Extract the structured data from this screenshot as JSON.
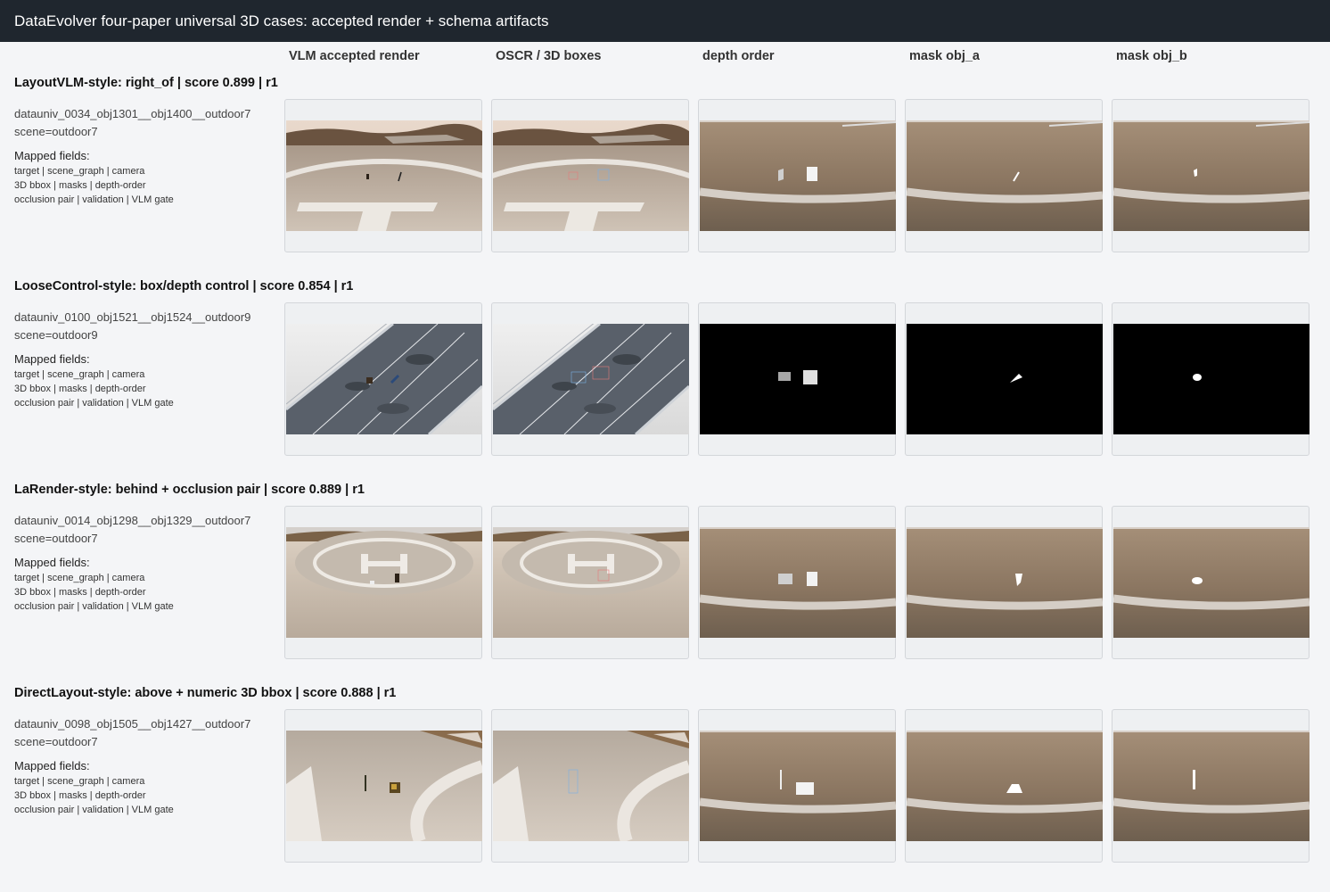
{
  "title": "DataEvolver four-paper universal 3D cases: accepted render + schema artifacts",
  "columns": [
    "VLM accepted render",
    "OSCR / 3D boxes",
    "depth order",
    "mask obj_a",
    "mask obj_b"
  ],
  "rows": [
    {
      "title": "LayoutVLM-style: right_of | score 0.899 | r1",
      "id": "datauniv_0034_obj1301__obj1400__outdoor7",
      "scene": "scene=outdoor7",
      "mapped_label": "Mapped fields:",
      "fields": [
        "target | scene_graph | camera",
        "3D bbox | masks | depth-order",
        "occlusion pair | validation | VLM gate"
      ],
      "style": "helipad-sky"
    },
    {
      "title": "LooseControl-style: box/depth control | score 0.854 | r1",
      "id": "datauniv_0100_obj1521__obj1524__outdoor9",
      "scene": "scene=outdoor9",
      "mapped_label": "Mapped fields:",
      "fields": [
        "target | scene_graph | camera",
        "3D bbox | masks | depth-order",
        "occlusion pair | validation | VLM gate"
      ],
      "style": "bridge"
    },
    {
      "title": "LaRender-style: behind + occlusion pair | score 0.889 | r1",
      "id": "datauniv_0014_obj1298__obj1329__outdoor7",
      "scene": "scene=outdoor7",
      "mapped_label": "Mapped fields:",
      "fields": [
        "target | scene_graph | camera",
        "3D bbox | masks | depth-order",
        "occlusion pair | validation | VLM gate"
      ],
      "style": "helipad-wide"
    },
    {
      "title": "DirectLayout-style: above + numeric 3D bbox | score 0.888 | r1",
      "id": "datauniv_0098_obj1505__obj1427__outdoor7",
      "scene": "scene=outdoor7",
      "mapped_label": "Mapped fields:",
      "fields": [
        "target | scene_graph | camera",
        "3D bbox | masks | depth-order",
        "occlusion pair | validation | VLM gate"
      ],
      "style": "helipad-side"
    }
  ]
}
